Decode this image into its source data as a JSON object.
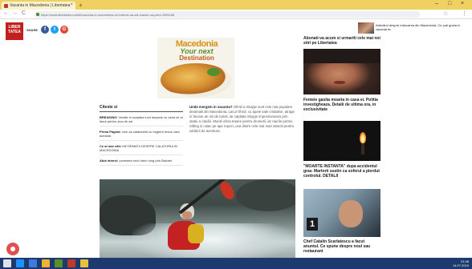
{
  "browser": {
    "tab_title": "Vacanta in Macedonia | Libertatea",
    "tab_close": "×",
    "new_tab": "+",
    "window_controls": [
      "–",
      "□",
      "×"
    ],
    "nav": [
      "←",
      "→",
      "C"
    ],
    "url": "https://www.libertatea.ro/stiri/vacanta-in-macedonia-ce-trebuie-sa-stii-inainte-sa-pleci-2981185",
    "toolbar_icons": [
      "☆",
      "⋮"
    ]
  },
  "site": {
    "logo_text": "LIBER TATEA",
    "share_label": "SHARE",
    "share_buttons": [
      {
        "label": "f",
        "color": "#3b5998"
      },
      {
        "label": "t",
        "color": "#1da1f2"
      },
      {
        "label": "G",
        "color": "#dd4b39"
      }
    ],
    "top_teaser": "Adevărul despre mâncarea din Macedonia. Ce poți gusta în vacanța ta."
  },
  "ad": {
    "line1": "Macedonia",
    "line2": "Your next",
    "line3": "Destination"
  },
  "left_column": {
    "heading": "Citeste si",
    "items": [
      {
        "bold": "BREAKING:",
        "text": "Vestile in noaptea lunii ianuarie cu ceea ce ai facut pentru ziua de azi"
      },
      {
        "bold": "Prima Pagina:",
        "text": "cum sa calatoresti cu bugetul redus vara aceasta"
      },
      {
        "bold": "Ce ai mai citit:",
        "text": "INFORMATII DESPRE CALATORIA IN MACEDONIA"
      },
      {
        "bold": "Abia intorsi:",
        "text": "povestea unui drum lung prin Balcani"
      }
    ]
  },
  "article": {
    "lead": "Unde mergem in vacanta?",
    "body": "Ohrid si Skopje sunt cele mai populare destinatii din Macedonia. Lacul Ohrid, cu apele sale cristaline, atrage in fiecare an mii de turisti, iar capitala Skopje impresioneaza prin statui si cladiri. Muntii ofera trasee pentru drumetii, iar raurile pentru rafting si caiac pe ape repezi, una dintre cele mai mari atractii pentru iubitorii de aventura."
  },
  "sidebar": {
    "items": [
      {
        "title": "Abonati-va acum si urmariti cele mai noi stiri pe Libertatea"
      },
      {
        "title": "Femeie gasita moarta in casa ei. Politia investigheaza. Detalii de ultima ora, in exclusivitate"
      },
      {
        "title": "\"MOARTE INSTANTA\" dupa accidentul grav. Martorii sustin ca soferul a pierdut controlul. DETALII"
      },
      {
        "title": "Chef Catalin Scarlatescu a facut anuntul. Ce spune despre noul sau restaurant"
      }
    ]
  },
  "taskbar": {
    "time": "21:48",
    "date": "14.07.2019",
    "apps": [
      "#1e90ff",
      "#3c7bd9",
      "#f2b130",
      "#5a8f2a",
      "#c0392b",
      "#e8c040"
    ]
  }
}
